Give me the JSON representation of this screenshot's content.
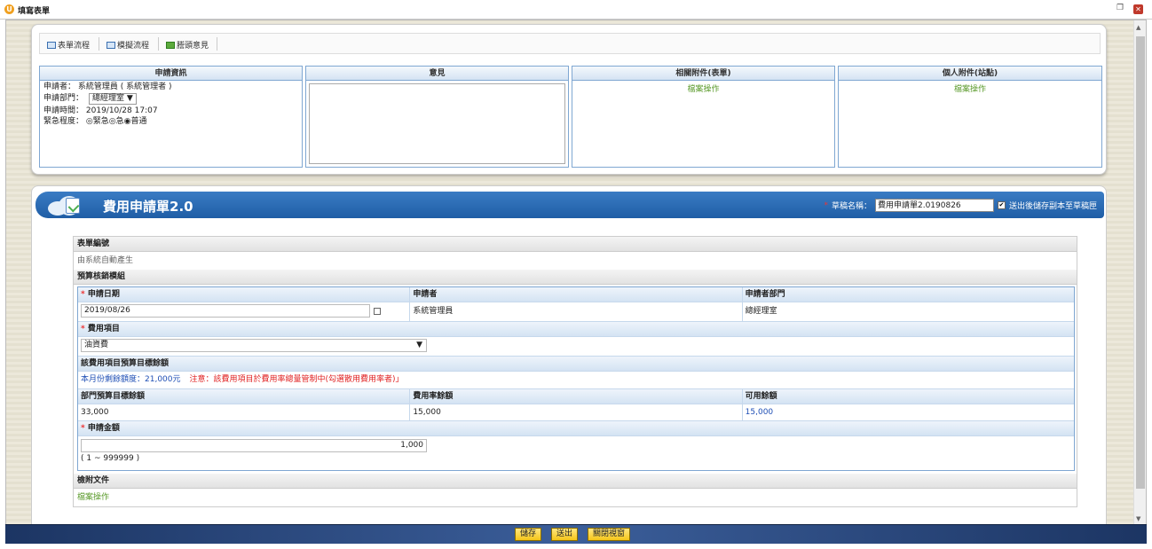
{
  "window": {
    "title": "填寫表單"
  },
  "toolbar": {
    "items": [
      "表單流程",
      "模擬流程",
      "謄頭意見"
    ]
  },
  "panels": {
    "apply_info": {
      "title": "申請資訊",
      "applicant_label": "申請者：",
      "applicant_value": "系統管理員 ( 系統管理者 )",
      "dept_label": "申請部門：",
      "dept_value": "總經理室 ▼",
      "time_label": "申請時間：",
      "time_value": "2019/10/28 17:07",
      "urgency_label": "緊急程度：",
      "urgency_options": [
        "緊急",
        "急",
        "普通"
      ],
      "urgency_selected": "普通"
    },
    "opinion": {
      "title": "意見"
    },
    "related_attach": {
      "title": "相關附件(表單)",
      "link": "檔案操作"
    },
    "personal_attach": {
      "title": "個人附件(站點)",
      "link": "檔案操作"
    }
  },
  "form": {
    "title": "費用申請單2.0",
    "draft_label": "草稿名稱：",
    "draft_value": "費用申請單2.0190826",
    "save_copy_label": "送出後儲存副本至草稿匣",
    "form_no_label": "表單編號",
    "form_no_value": "由系統自動產生",
    "budget_module_label": "預算核銷模組",
    "apply_date_label": "申請日期",
    "apply_date_value": "2019/08/26",
    "applicant_label": "申請者",
    "applicant_value": "系統管理員",
    "applicant_dept_label": "申請者部門",
    "applicant_dept_value": "總經理室",
    "expense_item_label": "費用項目",
    "expense_item_value": "油資費",
    "budget_balance_label": "該費用項目預算目標餘額",
    "balance_notice": "本月份剩餘額度：21,000元",
    "balance_warning": "注意：該費用項目於費用率總量管制中(勾選散用費用率者)」",
    "dept_budget_label": "部門預算目標餘額",
    "dept_budget_value": "33,000",
    "rate_balance_label": "費用率餘額",
    "rate_balance_value": "15,000",
    "available_label": "可用餘額",
    "available_value": "15,000",
    "amount_label": "申請金額",
    "amount_value": "1,000",
    "amount_range": "( 1 ~ 999999 )",
    "attach_label": "檢附文件",
    "attach_link": "檔案操作"
  },
  "bottom_buttons": {
    "save": "儲存",
    "submit": "送出",
    "close": "關閉視窗"
  },
  "colors": {
    "accent": "#2a6bb5",
    "required": "#e33333",
    "link": "#5a9a2a",
    "bottom_bar": "#1c3563"
  }
}
